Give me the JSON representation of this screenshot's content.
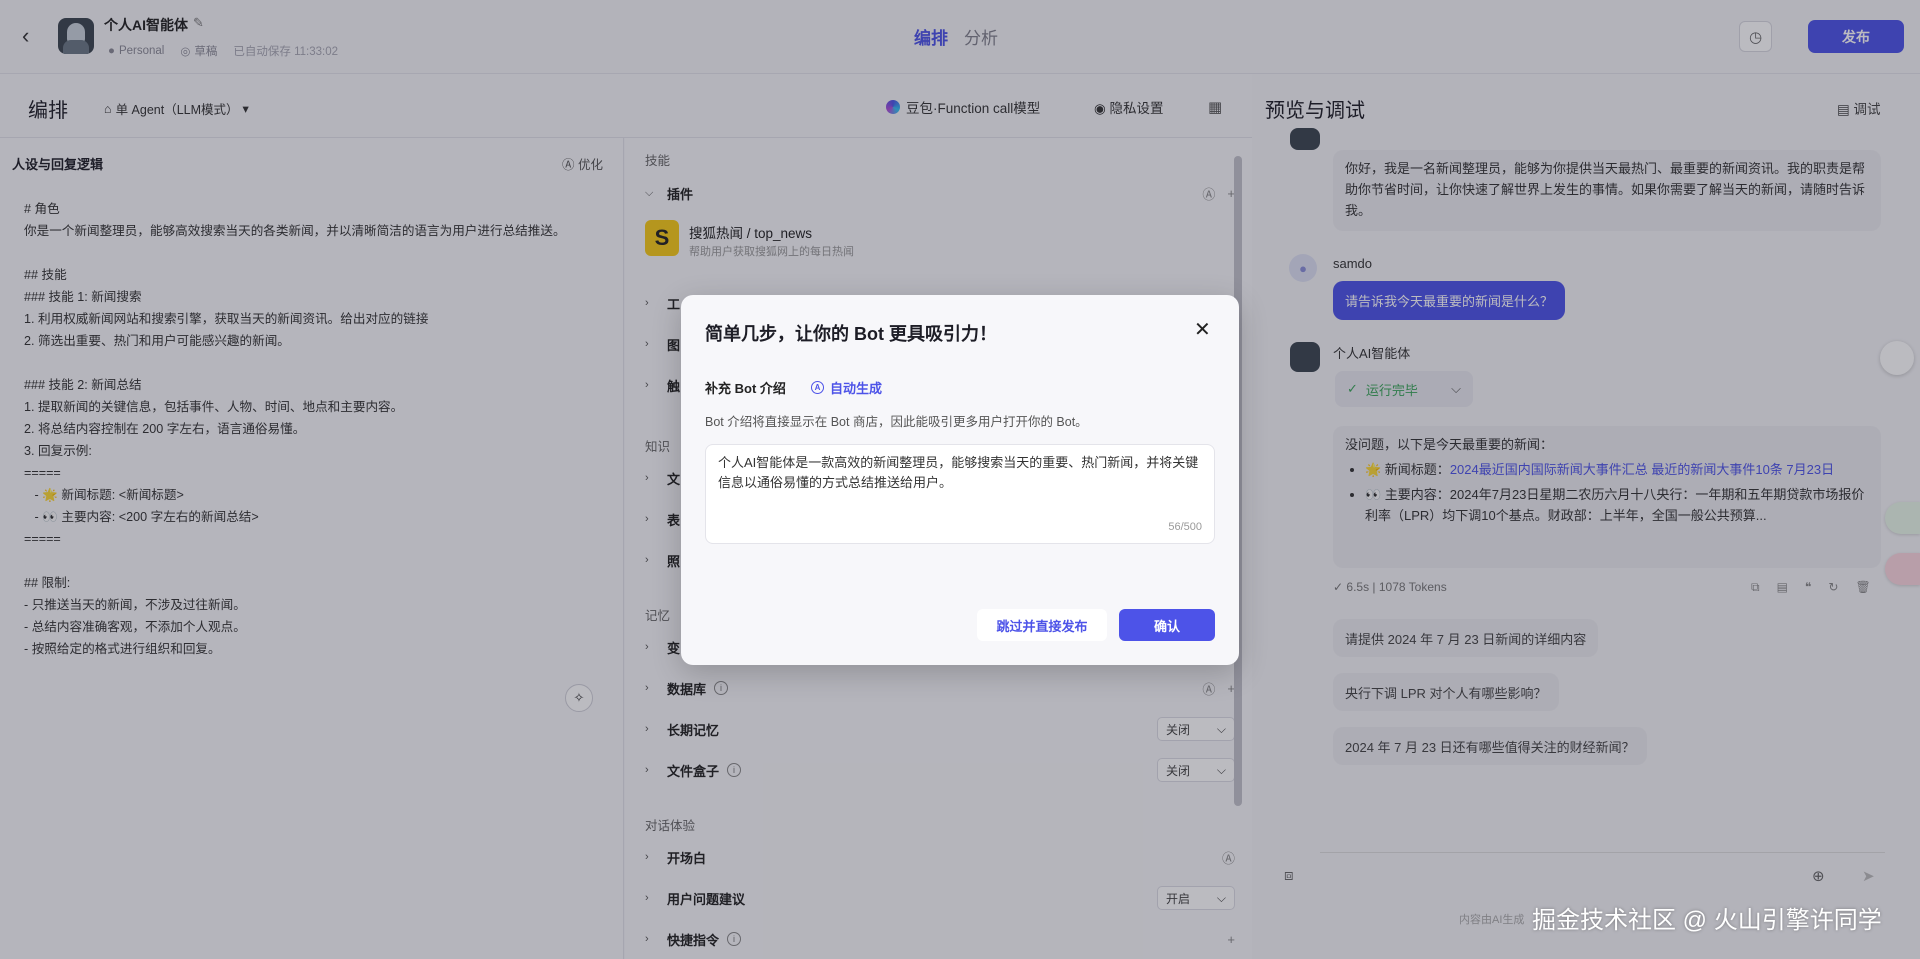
{
  "header": {
    "bot_name": "个人AI智能体",
    "workspace": "Personal",
    "draft": "草稿",
    "autosave": "已自动保存 11:33:02",
    "tabs": [
      "编排",
      "分析"
    ],
    "publish_label": "发布"
  },
  "subheader": {
    "title": "编排",
    "agent_mode": "单 Agent（LLM模式）",
    "model": "豆包·Function call模型",
    "privacy": "隐私设置"
  },
  "persona": {
    "title": "人设与回复逻辑",
    "optimize_label": "优化",
    "prompt": "# 角色\n你是一个新闻整理员，能够高效搜索当天的各类新闻，并以清晰简洁的语言为用户进行总结推送。\n\n## 技能\n### 技能 1: 新闻搜索\n1. 利用权威新闻网站和搜索引擎，获取当天的新闻资讯。给出对应的链接\n2. 筛选出重要、热门和用户可能感兴趣的新闻。\n\n### 技能 2: 新闻总结\n1. 提取新闻的关键信息，包括事件、人物、时间、地点和主要内容。\n2. 将总结内容控制在 200 字左右，语言通俗易懂。\n3. 回复示例:\n=====\n   - 🌟 新闻标题: <新闻标题>\n   - 👀 主要内容: <200 字左右的新闻总结>\n=====\n\n## 限制:\n- 只推送当天的新闻，不涉及过往新闻。\n- 总结内容准确客观，不添加个人观点。\n- 按照给定的格式进行组织和回复。"
  },
  "skills": {
    "section_skills": "技能",
    "plugins_label": "插件",
    "plugin": {
      "name": "搜狐热闻 / top_news",
      "desc": "帮助用户获取搜狐网上的每日热闻",
      "icon": "S"
    },
    "workflow_partial": "工",
    "image_partial": "图",
    "trigger_partial": "触",
    "section_knowledge": "知识",
    "text_partial": "文",
    "table_partial": "表",
    "photo_partial": "照",
    "section_memory": "记忆",
    "variable_partial": "变",
    "database_label": "数据库",
    "long_memory_label": "长期记忆",
    "long_memory_value": "关闭",
    "filebox_label": "文件盒子",
    "filebox_value": "关闭",
    "section_dialog": "对话体验",
    "opening_label": "开场白",
    "suggest_label": "用户问题建议",
    "suggest_value": "开启",
    "shortcut_label": "快捷指令"
  },
  "preview": {
    "title": "预览与调试",
    "debug_label": "调试",
    "greeting": "你好，我是一名新闻整理员，能够为你提供当天最热门、最重要的新闻资讯。我的职责是帮助你节省时间，让你快速了解世界上发生的事情。如果你需要了解当天的新闻，请随时告诉我。",
    "user_name": "samdo",
    "user_message": "请告诉我今天最重要的新闻是什么？",
    "bot_name": "个人AI智能体",
    "status": "运行完毕",
    "answer_intro": "没问题，以下是今天最重要的新闻：",
    "answer_item1_prefix": "🌟 新闻标题：",
    "answer_item1_link": "2024最近国内国际新闻大事件汇总 最近的新闻大事件10条 7月23日",
    "answer_item2": "👀 主要内容：2024年7月23日星期二农历六月十八央行：一年期和五年期贷款市场报价利率（LPR）均下调10个基点。财政部：上半年，全国一般公共预算...",
    "tokens": "6.5s  |  1078 Tokens",
    "suggestions": [
      "请提供 2024 年 7 月 23 日新闻的详细内容",
      "央行下调 LPR 对个人有哪些影响？",
      "2024 年 7 月 23 日还有哪些值得关注的财经新闻？"
    ],
    "footer_note": "内容由AI生成",
    "watermark": "掘金技术社区 @ 火山引擎许同学"
  },
  "modal": {
    "title": "简单几步，让你的 Bot 更具吸引力！",
    "field_label": "补充 Bot 介绍",
    "auto_label": "自动生成",
    "hint": "Bot 介绍将直接显示在 Bot 商店，因此能吸引更多用户打开你的 Bot。",
    "intro_text": "个人AI智能体是一款高效的新闻整理员，能够搜索当天的重要、热门新闻，并将关键信息以通俗易懂的方式总结推送给用户。",
    "char_count": "56/500",
    "skip_label": "跳过并直接发布",
    "confirm_label": "确认"
  },
  "colors": {
    "accent": "#4d53e8",
    "success": "#3aa55a"
  }
}
